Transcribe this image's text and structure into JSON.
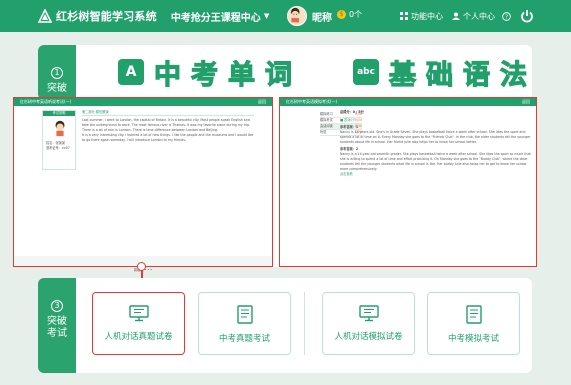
{
  "topbar": {
    "brand": "红杉树智能学习系统",
    "center_menu": "中考抢分王课程中心",
    "nickname": "昵称",
    "coins": "0个",
    "nav_items": [
      "功能中心",
      "个人中心"
    ]
  },
  "section1": {
    "num": "1",
    "label": "突破",
    "word_badge": "A",
    "word_title": "中考单词",
    "grammar_badge": "abc",
    "grammar_title": "基础语法"
  },
  "left_window": {
    "title": "红杉树中考英语听说考试(一)",
    "close": "返回",
    "sidebar_title": "考试说明",
    "candidate": [
      "姓名：张某某",
      "准考证号：xx07"
    ],
    "article_header": "第二部分  模仿朗读",
    "paragraphs": [
      "Last summer, I went to London, the capital of Britain. It is a beautiful city. Most people speak English and take the underground to work. The most famous river is Thames. It was my favorite place during my trip. There is a lot of rain in London. There is time difference between London and Beijing.",
      "It is a very interesting city. I learned a lot of new things. I like the people and the museums and I would like to go there again someday. I will introduce London to my friends."
    ],
    "footer": "阅读中 • • •"
  },
  "right_window": {
    "title": "红杉树中考英语模拟考试(一)",
    "close": "返回",
    "menu": [
      {
        "label": "模拟练习",
        "score": "0/30"
      },
      {
        "label": "模拟考试",
        "score": "0/30"
      },
      {
        "label": "会话阅读",
        "score": "0/30"
      },
      {
        "label": "听说",
        "score": "0/30"
      }
    ],
    "header": "总得分：0 / 5分",
    "status": "■ 答对0个",
    "ref_label_1": "参考答案：1",
    "answer_1": "Nancy is 14 years old. She's in Grade Seven. She plays basketball twice a week after school. She likes the sport and spends a lot of time on it. Every Monday she goes to the \"Friends Club\". In the club, the older students tell the younger students about life in school. Her friend Julie also helps her to know her school better.",
    "ref_label_2": "参考答案：2",
    "answer_2": "Nancy is a 14-year-old seventh grader. She plays basketball twice a week after school. She likes the sport so much that she is willing to spend a lot of time and effort practicing it. On Monday she goes to the \"Buddy Club\", where the older students tell the younger students what life in school is like. Her buddy Julie also helps her to get to know her school more comprehensively.",
    "more": "点击查看"
  },
  "section3": {
    "num": "3",
    "label": "突破考试",
    "buttons": [
      "人机对话真题试卷",
      "中考真题考试",
      "人机对话模拟试卷",
      "中考模拟考试"
    ]
  }
}
